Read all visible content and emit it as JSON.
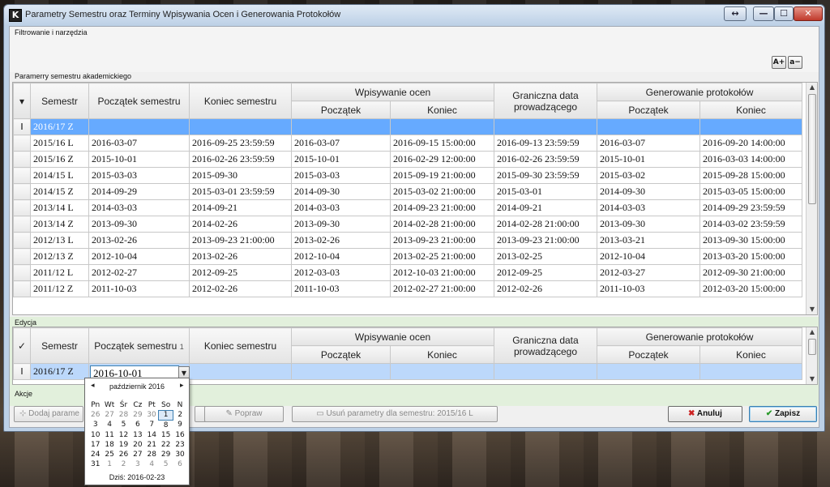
{
  "window": {
    "title": "Parametry Semestru oraz Terminy Wpisywania Ocen i Generowania Protokołów",
    "app_icon": "K",
    "buttons": {
      "restore": "↔",
      "minimize": "—",
      "maximize": "☐",
      "close": "✕"
    }
  },
  "filter": {
    "label": "Filtrowanie i narzędzia",
    "font_plus": "A+",
    "font_minus": "a−"
  },
  "grid_section_label": "Paramerry semestru akademickiego",
  "headers": {
    "semestr": "Semestr",
    "poczatek_semestru": "Początek semestru",
    "koniec_semestru": "Koniec semestru",
    "wpisywanie_ocen": "Wpisywanie ocen",
    "graniczna_1": "Graniczna data",
    "graniczna_2": "prowadzącego",
    "generowanie_protokolow": "Generowanie protokołów",
    "poczatek": "Początek",
    "koniec": "Koniec"
  },
  "rows": [
    {
      "semestr": "2016/17 Z",
      "pocz_sem": "",
      "kon_sem": "",
      "wp_pocz": "",
      "wp_kon": "",
      "gran": "",
      "gen_pocz": "",
      "gen_kon": ""
    },
    {
      "semestr": "2015/16 L",
      "pocz_sem": "2016-03-07",
      "kon_sem": "2016-09-25 23:59:59",
      "wp_pocz": "2016-03-07",
      "wp_kon": "2016-09-15 15:00:00",
      "gran": "2016-09-13 23:59:59",
      "gen_pocz": "2016-03-07",
      "gen_kon": "2016-09-20 14:00:00"
    },
    {
      "semestr": "2015/16 Z",
      "pocz_sem": "2015-10-01",
      "kon_sem": "2016-02-26 23:59:59",
      "wp_pocz": "2015-10-01",
      "wp_kon": "2016-02-29 12:00:00",
      "gran": "2016-02-26 23:59:59",
      "gen_pocz": "2015-10-01",
      "gen_kon": "2016-03-03 14:00:00"
    },
    {
      "semestr": "2014/15 L",
      "pocz_sem": "2015-03-03",
      "kon_sem": "2015-09-30",
      "wp_pocz": "2015-03-03",
      "wp_kon": "2015-09-19 21:00:00",
      "gran": "2015-09-30 23:59:59",
      "gen_pocz": "2015-03-02",
      "gen_kon": "2015-09-28 15:00:00"
    },
    {
      "semestr": "2014/15 Z",
      "pocz_sem": "2014-09-29",
      "kon_sem": "2015-03-01 23:59:59",
      "wp_pocz": "2014-09-30",
      "wp_kon": "2015-03-02 21:00:00",
      "gran": "2015-03-01",
      "gen_pocz": "2014-09-30",
      "gen_kon": "2015-03-05 15:00:00"
    },
    {
      "semestr": "2013/14 L",
      "pocz_sem": "2014-03-03",
      "kon_sem": "2014-09-21",
      "wp_pocz": "2014-03-03",
      "wp_kon": "2014-09-23 21:00:00",
      "gran": "2014-09-21",
      "gen_pocz": "2014-03-03",
      "gen_kon": "2014-09-29 23:59:59"
    },
    {
      "semestr": "2013/14 Z",
      "pocz_sem": "2013-09-30",
      "kon_sem": "2014-02-26",
      "wp_pocz": "2013-09-30",
      "wp_kon": "2014-02-28 21:00:00",
      "gran": "2014-02-28 21:00:00",
      "gen_pocz": "2013-09-30",
      "gen_kon": "2014-03-02 23:59:59"
    },
    {
      "semestr": "2012/13 L",
      "pocz_sem": "2013-02-26",
      "kon_sem": "2013-09-23 21:00:00",
      "wp_pocz": "2013-02-26",
      "wp_kon": "2013-09-23 21:00:00",
      "gran": "2013-09-23 21:00:00",
      "gen_pocz": "2013-03-21",
      "gen_kon": "2013-09-30 15:00:00"
    },
    {
      "semestr": "2012/13 Z",
      "pocz_sem": "2012-10-04",
      "kon_sem": "2013-02-26",
      "wp_pocz": "2012-10-04",
      "wp_kon": "2013-02-25 21:00:00",
      "gran": "2013-02-25",
      "gen_pocz": "2012-10-04",
      "gen_kon": "2013-03-20 15:00:00"
    },
    {
      "semestr": "2011/12 L",
      "pocz_sem": "2012-02-27",
      "kon_sem": "2012-09-25",
      "wp_pocz": "2012-03-03",
      "wp_kon": "2012-10-03 21:00:00",
      "gran": "2012-09-25",
      "gen_pocz": "2012-03-27",
      "gen_kon": "2012-09-30 21:00:00"
    },
    {
      "semestr": "2011/12 Z",
      "pocz_sem": "2011-10-03",
      "kon_sem": "2012-02-26",
      "wp_pocz": "2011-10-03",
      "wp_kon": "2012-02-27 21:00:00",
      "gran": "2012-02-26",
      "gen_pocz": "2011-10-03",
      "gen_kon": "2012-03-20 15:00:00"
    }
  ],
  "edit": {
    "label": "Edycja",
    "row_semestr": "2016/17 Z",
    "input_value": "2016-10-01",
    "sort_indicator": "1"
  },
  "actions": {
    "label": "Akcje",
    "add": "Dodaj parame",
    "fix": "Popraw",
    "remove": "Usuń parametry dla semestru: 2015/16 L",
    "cancel": "Anuluj",
    "save": "Zapisz"
  },
  "calendar": {
    "month": "październik 2016",
    "prev": "◂",
    "next": "▸",
    "day_names": [
      "Pn",
      "Wt",
      "Śr",
      "Cz",
      "Pt",
      "So",
      "N"
    ],
    "weeks": [
      [
        "26",
        "27",
        "28",
        "29",
        "30",
        "1",
        "2"
      ],
      [
        "3",
        "4",
        "5",
        "6",
        "7",
        "8",
        "9"
      ],
      [
        "10",
        "11",
        "12",
        "13",
        "14",
        "15",
        "16"
      ],
      [
        "17",
        "18",
        "19",
        "20",
        "21",
        "22",
        "23"
      ],
      [
        "24",
        "25",
        "26",
        "27",
        "28",
        "29",
        "30"
      ],
      [
        "31",
        "1",
        "2",
        "3",
        "4",
        "5",
        "6"
      ]
    ],
    "today": "Dziś: 2016-02-23"
  },
  "colors": {
    "selected_row": "#66aaff",
    "edit_row": "#bcd8fb",
    "cancel_icon": "#cc2222",
    "save_icon": "#2a9a2a"
  }
}
